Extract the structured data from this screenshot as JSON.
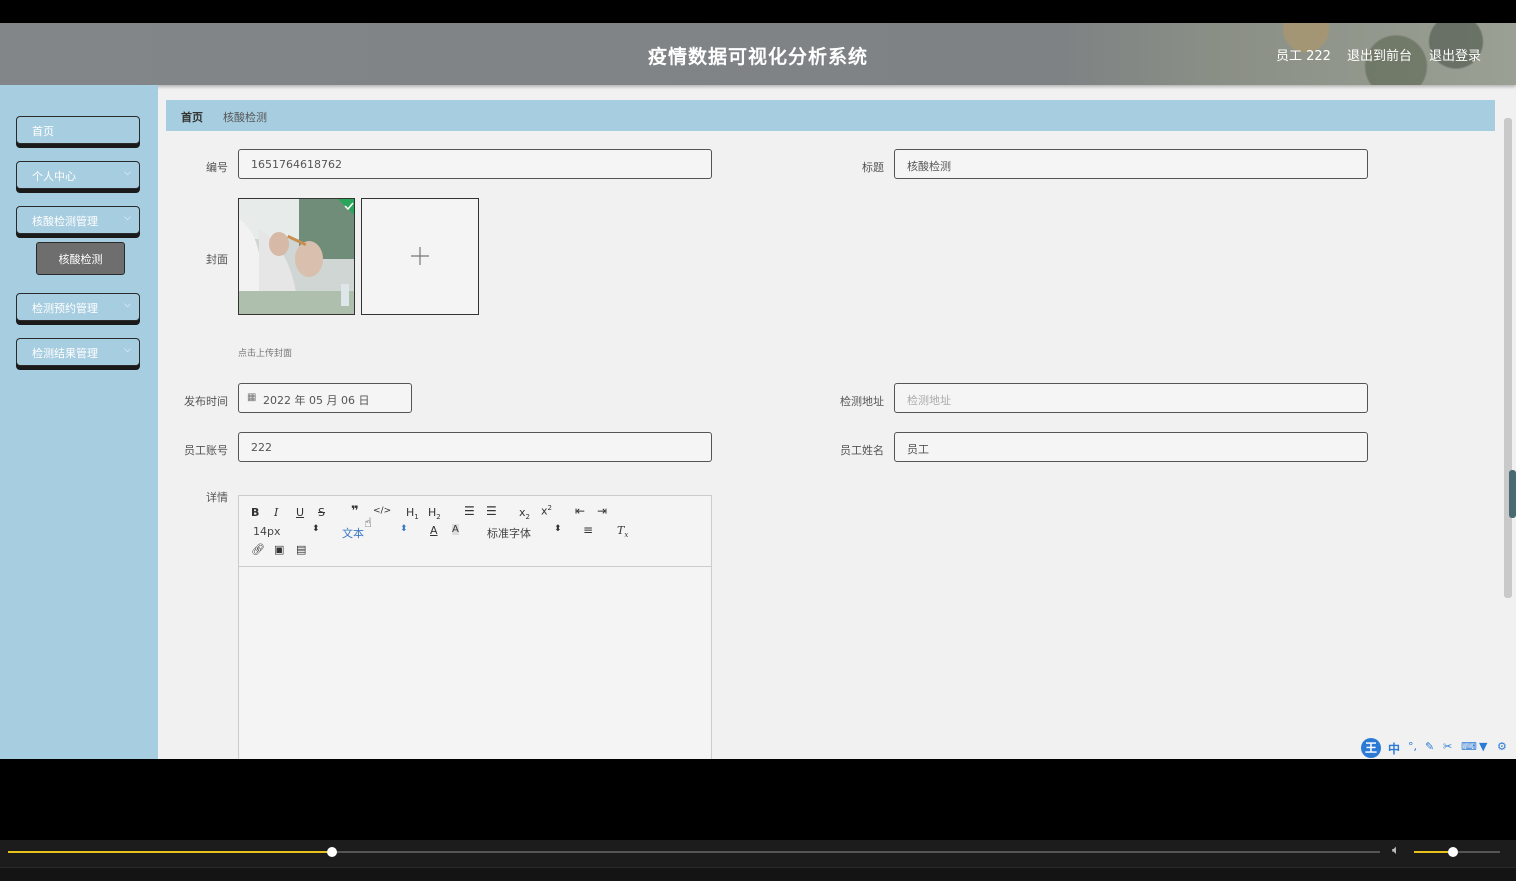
{
  "header": {
    "title": "疫情数据可视化分析系统",
    "user": "员工 222",
    "to_front": "退出到前台",
    "logout": "退出登录"
  },
  "sidebar": {
    "items": [
      {
        "label": "首页"
      },
      {
        "label": "个人中心"
      },
      {
        "label": "核酸检测管理"
      },
      {
        "label": "核酸检测"
      },
      {
        "label": "检测预约管理"
      },
      {
        "label": "检测结果管理"
      }
    ]
  },
  "breadcrumb": {
    "home": "首页",
    "current": "核酸检测"
  },
  "form": {
    "number_label": "编号",
    "number_value": "1651764618762",
    "title_label": "标题",
    "title_value": "核酸检测",
    "cover_label": "封面",
    "cover_hint": "点击上传封面",
    "publish_label": "发布时间",
    "publish_value": "2022 年 05 月 06 日",
    "address_label": "检测地址",
    "address_placeholder": "检测地址",
    "account_label": "员工账号",
    "account_value": "222",
    "name_label": "员工姓名",
    "name_value": "员工",
    "detail_label": "详情"
  },
  "editor": {
    "font_size": "14px",
    "text_style": "文本",
    "font_family": "标准字体"
  },
  "ime": {
    "lang": "中"
  },
  "player": {
    "progress": 0.236,
    "volume": 0.45
  },
  "colors": {
    "sidebar": "#a7cde0",
    "header": "#808486",
    "progress": "#e8c21b"
  }
}
